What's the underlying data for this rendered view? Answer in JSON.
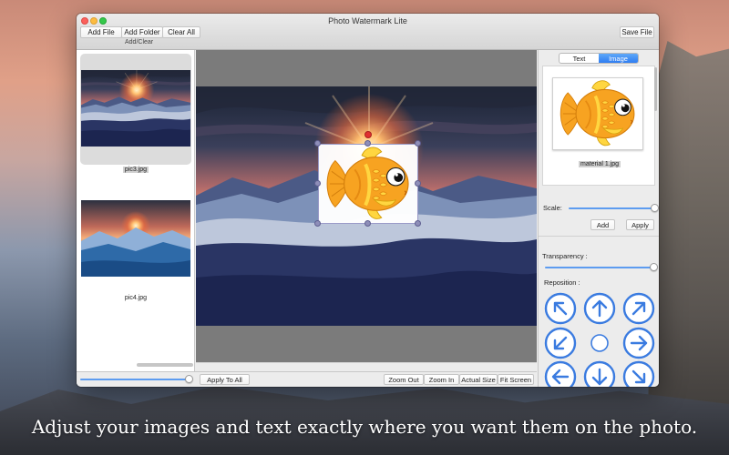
{
  "window": {
    "title": "Photo Watermark Lite"
  },
  "toolbar": {
    "add_file": "Add File",
    "add_folder": "Add Folder",
    "clear_all": "Clear All",
    "group_label": "Add/Clear",
    "save_file": "Save File"
  },
  "file_list": {
    "items": [
      {
        "name": "pic3.jpg",
        "selected": true
      },
      {
        "name": "pic4.jpg",
        "selected": false
      }
    ]
  },
  "right_panel": {
    "tabs": [
      "Text",
      "Image"
    ],
    "active_tab": "Image",
    "material_name": "material 1.jpg",
    "scale_label": "Scale:",
    "scale_value": 1.0,
    "add_label": "Add",
    "apply_label": "Apply",
    "transparency_label": "Transparency :",
    "transparency_value": 1.0,
    "reposition_label": "Reposition :"
  },
  "bottom": {
    "thumb_size_value": 1.0,
    "apply_to_all": "Apply To All",
    "zoom_out": "Zoom Out",
    "zoom_in": "Zoom In",
    "actual_size": "Actual Size",
    "fit_screen": "Fit Screen"
  },
  "caption": "Adjust your images and text exactly where you want them on the photo.",
  "colors": {
    "accent": "#2f7df2",
    "arrow_button": "#3a7be0",
    "handle": "#8e8eb8",
    "rotate_handle": "#e03030",
    "fish_body": "#f7a321"
  },
  "icons": {
    "reposition": [
      "arrow-up-left-icon",
      "arrow-up-icon",
      "arrow-up-right-icon",
      "arrow-left-down-icon",
      "center-circle-icon",
      "arrow-right-icon",
      "arrow-left-icon",
      "arrow-down-icon",
      "arrow-down-right-icon"
    ]
  }
}
